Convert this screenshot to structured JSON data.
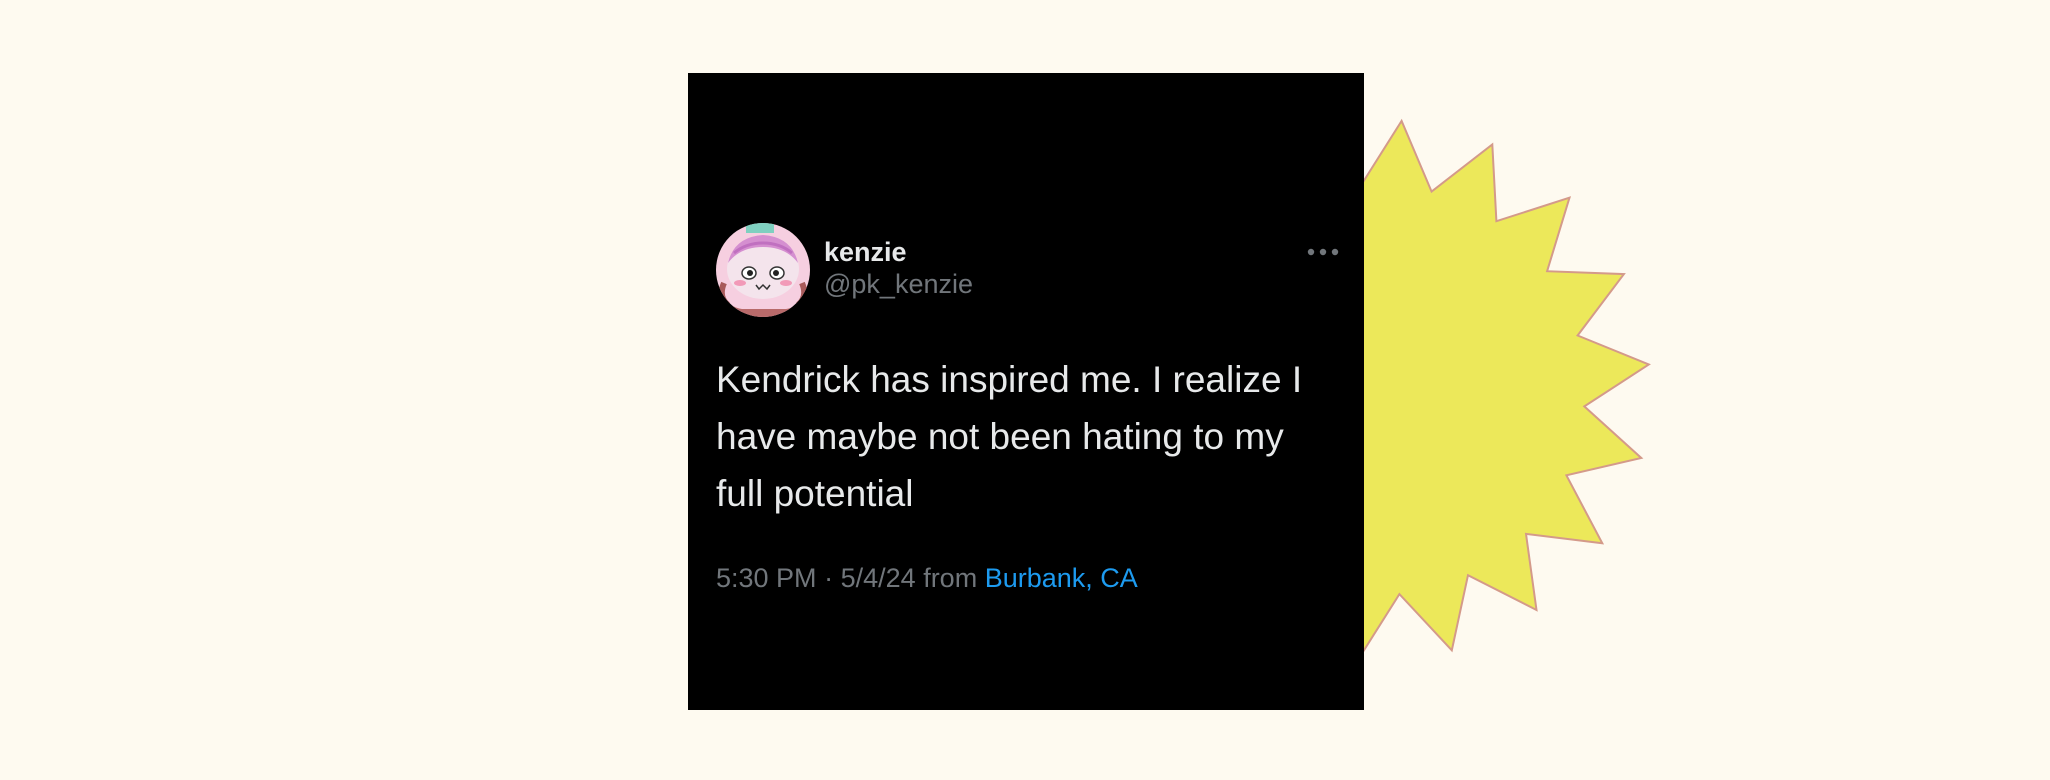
{
  "decoration": {
    "starburst_fill": "#ece85a",
    "starburst_stroke": "#d49a8a",
    "background": "#fefaf0"
  },
  "tweet": {
    "author_name": "kenzie",
    "author_handle": "@pk_kenzie",
    "avatar_icon": "cartoon-character-avatar",
    "more_icon": "more-options-icon",
    "text": "Kendrick has inspired me. I realize I have maybe not been hating to my full potential",
    "time": "5:30 PM",
    "separator": "·",
    "date": "5/4/24",
    "from_label": "from",
    "location": "Burbank, CA",
    "card_background": "#000000",
    "link_color": "#1d9bf0"
  }
}
